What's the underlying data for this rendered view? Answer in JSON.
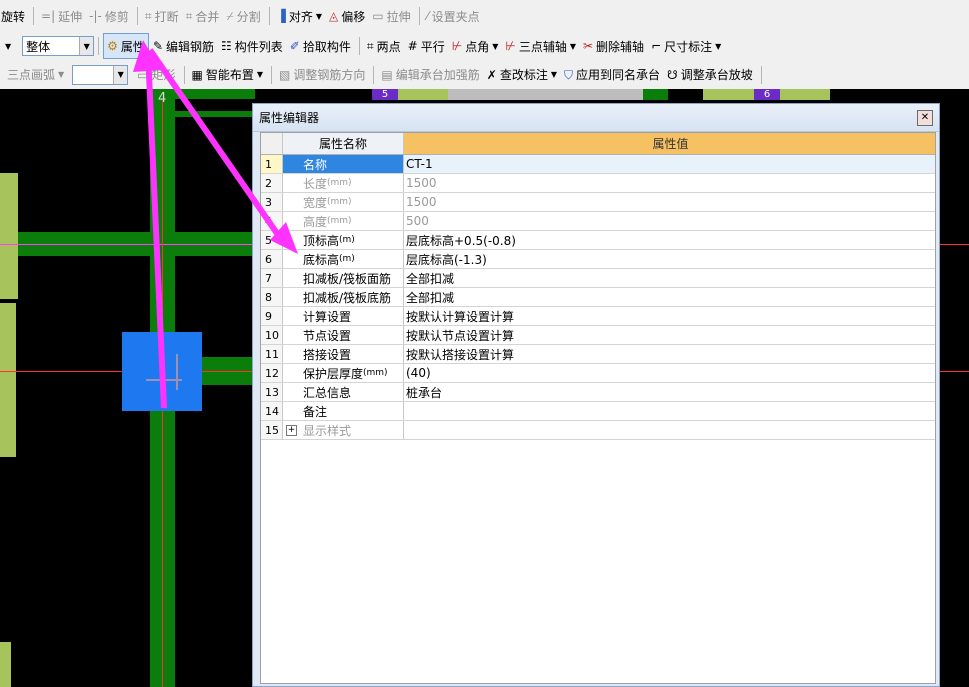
{
  "toolbar1": {
    "rotate": "旋转",
    "extend": "延伸",
    "trim": "修剪",
    "break": "打断",
    "merge": "合并",
    "split": "分割",
    "align": "对齐",
    "offset": "偏移",
    "stretch": "拉伸",
    "set_grip": "设置夹点"
  },
  "toolbar2": {
    "scope_value": "整体",
    "attribute": "属性",
    "edit_rebar": "编辑钢筋",
    "component_list": "构件列表",
    "pick_component": "拾取构件",
    "two_points": "两点",
    "parallel": "平行",
    "point_angle": "点角",
    "three_point_axis": "三点辅轴",
    "delete_axis": "删除辅轴",
    "dimension": "尺寸标注"
  },
  "toolbar3": {
    "three_point_arc": "三点画弧",
    "rectangle": "矩形",
    "smart_layout": "智能布置",
    "adjust_rebar_dir": "调整钢筋方向",
    "edit_cap_rebar": "编辑承台加强筋",
    "check_annotation": "查改标注",
    "apply_same_name": "应用到同名承台",
    "adjust_slope": "调整承台放坡"
  },
  "canvas": {
    "axis_4": "4",
    "axis_5": "5",
    "axis_6": "6"
  },
  "dialog": {
    "title": "属性编辑器",
    "col_name": "属性名称",
    "col_value": "属性值",
    "rows": [
      {
        "num": "1",
        "name": "名称",
        "value": "CT-1"
      },
      {
        "num": "2",
        "name": "长度",
        "unit": "(mm)",
        "value": "1500"
      },
      {
        "num": "3",
        "name": "宽度",
        "unit": "(mm)",
        "value": "1500"
      },
      {
        "num": "4",
        "name": "高度",
        "unit": "(mm)",
        "value": "500"
      },
      {
        "num": "5",
        "name": "顶标高",
        "unit": "(m)",
        "value": "层底标高+0.5(-0.8)"
      },
      {
        "num": "6",
        "name": "底标高",
        "unit": "(m)",
        "value": "层底标高(-1.3)"
      },
      {
        "num": "7",
        "name": "扣减板/筏板面筋",
        "value": "全部扣减"
      },
      {
        "num": "8",
        "name": "扣减板/筏板底筋",
        "value": "全部扣减"
      },
      {
        "num": "9",
        "name": "计算设置",
        "value": "按默认计算设置计算"
      },
      {
        "num": "10",
        "name": "节点设置",
        "value": "按默认节点设置计算"
      },
      {
        "num": "11",
        "name": "搭接设置",
        "value": "按默认搭接设置计算"
      },
      {
        "num": "12",
        "name": "保护层厚度",
        "unit": "(mm)",
        "value": "(40)"
      },
      {
        "num": "13",
        "name": "汇总信息",
        "value": "桩承台"
      },
      {
        "num": "14",
        "name": "备注",
        "value": ""
      },
      {
        "num": "15",
        "name": "显示样式",
        "value": ""
      }
    ]
  },
  "colors": {
    "selection_blue": "#2f86e0",
    "header_orange": "#f6c163",
    "annotation_magenta": "#ff33ff",
    "beam_green": "#0b7d0b",
    "cap_blue": "#1e78f0"
  }
}
